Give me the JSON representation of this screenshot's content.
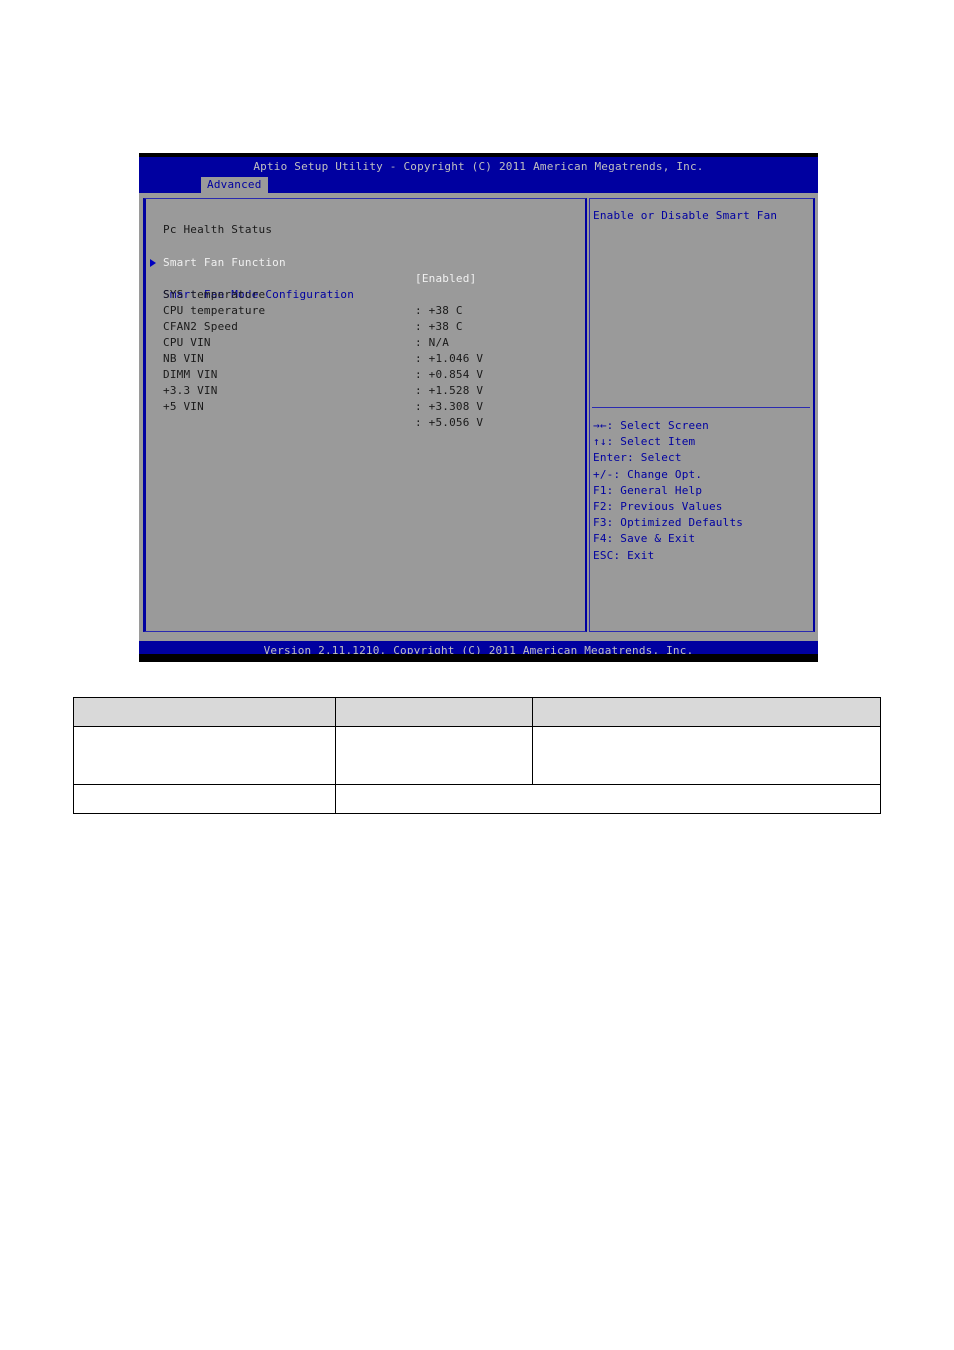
{
  "bios": {
    "title": "Aptio Setup Utility - Copyright (C) 2011 American Megatrends, Inc.",
    "active_tab": "Advanced",
    "footer": "Version 2.11.1210. Copyright (C) 2011 American Megatrends, Inc.",
    "colors": {
      "header_bg": "#0000a0",
      "panel_bg": "#9a9a9a",
      "help_text": "#0000a0"
    },
    "section_title": "Pc Health Status",
    "smart_fan_function": {
      "label": "Smart Fan Function",
      "value": "[Enabled]"
    },
    "submenu": {
      "label": "Smart Fan Mode Configuration",
      "icon": "triangle-right-icon"
    },
    "readings": [
      {
        "label": "SYS temperature",
        "value": ": +38 C"
      },
      {
        "label": "CPU temperature",
        "value": ": +38 C"
      },
      {
        "label": "CFAN2 Speed",
        "value": ": N/A"
      },
      {
        "label": "CPU VIN",
        "value": ": +1.046 V"
      },
      {
        "label": "NB VIN",
        "value": ": +0.854 V"
      },
      {
        "label": "DIMM VIN",
        "value": ": +1.528 V"
      },
      {
        "label": "+3.3 VIN",
        "value": ": +3.308 V"
      },
      {
        "label": "+5 VIN",
        "value": ": +5.056 V"
      }
    ],
    "help": "Enable or Disable Smart Fan",
    "keys": [
      "→←: Select Screen",
      "↑↓: Select Item",
      "Enter: Select",
      "+/-: Change Opt.",
      "F1: General Help",
      "F2: Previous Values",
      "F3: Optimized Defaults",
      "F4: Save & Exit",
      "ESC: Exit"
    ]
  },
  "doc_table": {
    "header": [
      "",
      "",
      ""
    ],
    "row1": [
      "",
      "",
      ""
    ],
    "row2": [
      "",
      ""
    ]
  }
}
